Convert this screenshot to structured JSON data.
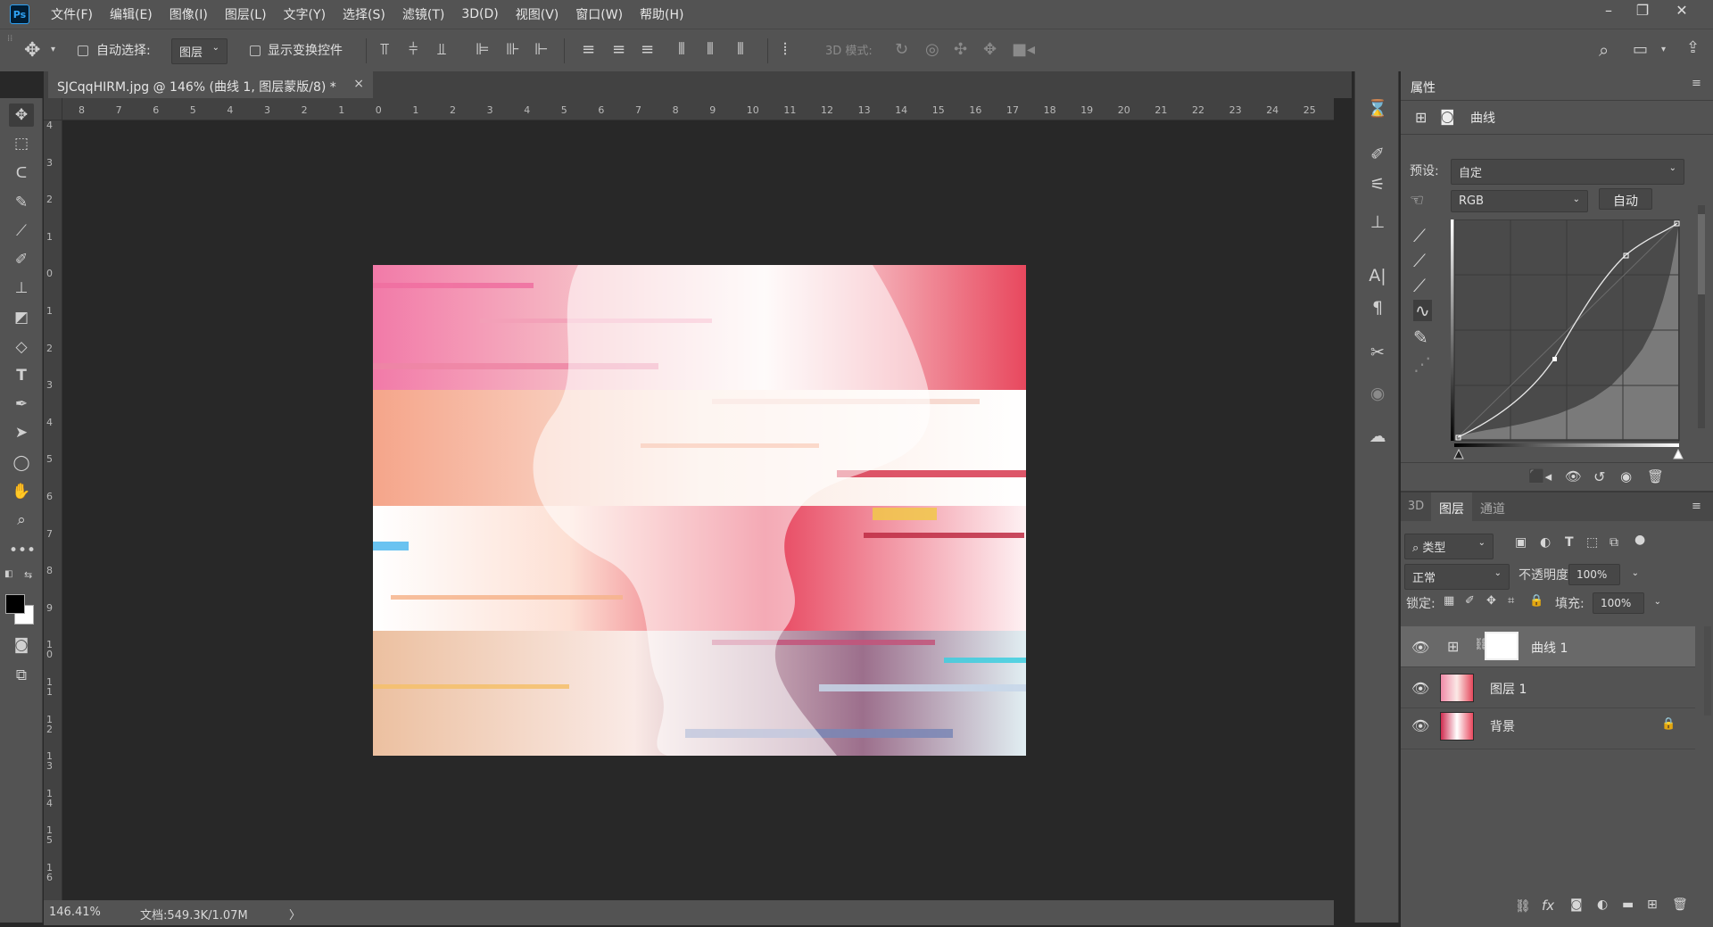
{
  "app": {
    "logo": "Ps"
  },
  "menu": [
    "文件(F)",
    "编辑(E)",
    "图像(I)",
    "图层(L)",
    "文字(Y)",
    "选择(S)",
    "滤镜(T)",
    "3D(D)",
    "视图(V)",
    "窗口(W)",
    "帮助(H)"
  ],
  "window_controls": {
    "minimize": "–",
    "restore": "❐",
    "close": "✕"
  },
  "options": {
    "auto_select_label": "自动选择:",
    "auto_select_value": "图层",
    "show_transform_label": "显示变换控件",
    "mode_3d_label": "3D 模式:"
  },
  "document": {
    "tab_title": "SJCqqHIRM.jpg @ 146% (曲线 1, 图层蒙版/8) *",
    "tab_close": "×"
  },
  "ruler": {
    "h_labels": [
      "8",
      "7",
      "6",
      "5",
      "4",
      "3",
      "2",
      "1",
      "0",
      "1",
      "2",
      "3",
      "4",
      "5",
      "6",
      "7",
      "8",
      "9",
      "10",
      "11",
      "12",
      "13",
      "14",
      "15",
      "16",
      "17",
      "18",
      "19",
      "20",
      "21",
      "22",
      "23",
      "24",
      "25"
    ],
    "v_labels": [
      "4",
      "3",
      "2",
      "1",
      "0",
      "1",
      "2",
      "3",
      "4",
      "5",
      "6",
      "7",
      "8",
      "9",
      "1 0",
      "1 1",
      "1 2",
      "1 3",
      "1 4",
      "1 5",
      "1 6"
    ]
  },
  "status": {
    "zoom": "146.41%",
    "doc_info": "文档:549.3K/1.07M",
    "arrow": "〉"
  },
  "properties": {
    "tab": "属性",
    "adjustment_name": "曲线",
    "preset_label": "预设:",
    "preset_value": "自定",
    "channel_value": "RGB",
    "auto_button": "自动"
  },
  "layers_panel": {
    "tabs": [
      "3D",
      "图层",
      "通道"
    ],
    "filter_kind": "类型",
    "blend_mode": "正常",
    "opacity_label": "不透明度:",
    "opacity_value": "100%",
    "lock_label": "锁定:",
    "fill_label": "填充:",
    "fill_value": "100%",
    "layers": [
      {
        "name": "曲线 1"
      },
      {
        "name": "图层 1"
      },
      {
        "name": "背景"
      }
    ],
    "bottom_fx": "fx"
  },
  "colors": {
    "accent": "#2fa3f6",
    "panel": "#535353",
    "canvas": "#282828"
  }
}
